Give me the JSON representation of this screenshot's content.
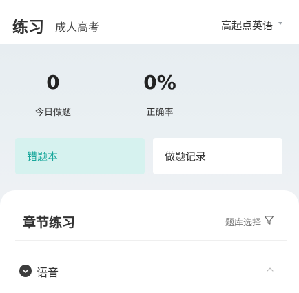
{
  "header": {
    "title": "练习",
    "subtitle": "成人高考",
    "course": "高起点英语"
  },
  "stats": {
    "today_count": "0",
    "today_label": "今日做题",
    "accuracy": "0%",
    "accuracy_label": "正确率"
  },
  "cards": {
    "wrong_book": "错题本",
    "records": "做题记录"
  },
  "chapter": {
    "title": "章节练习",
    "bank_select": "题库选择",
    "sections": [
      {
        "label": "语音"
      }
    ]
  },
  "colors": {
    "accent": "#1aa89c",
    "accent_bg": "#d6f2ef",
    "page_bg": "#eef1f4"
  }
}
